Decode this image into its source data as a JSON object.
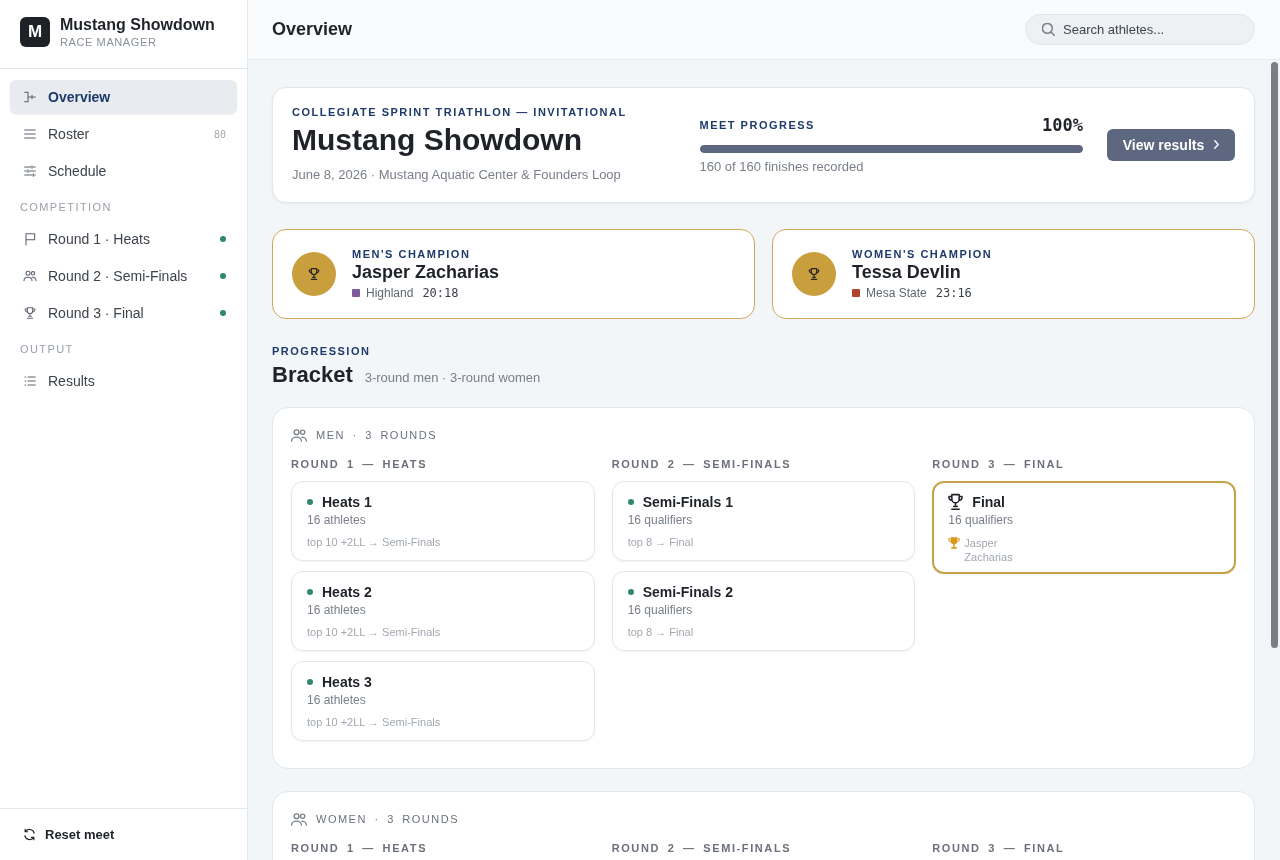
{
  "sidebar": {
    "brand": {
      "logo": "M",
      "title": "Mustang Showdown",
      "subtitle": "RACE MANAGER"
    },
    "sections": [
      {
        "items": [
          {
            "label": "Overview",
            "selected": true
          },
          {
            "label": "Roster",
            "count": "80",
            "selected": false
          },
          {
            "label": "Schedule",
            "selected": false
          }
        ]
      },
      {
        "heading": "COMPETITION",
        "items": [
          {
            "label": "Round 1 · Heats",
            "done": true,
            "selected": false
          },
          {
            "label": "Round 2 · Semi-Finals",
            "done": true,
            "selected": false
          },
          {
            "label": "Round 3 · Final",
            "done": true,
            "selected": false
          }
        ]
      },
      {
        "heading": "OUTPUT",
        "items": [
          {
            "label": "Results",
            "selected": false
          }
        ]
      }
    ],
    "footer": {
      "button": "Reset meet"
    }
  },
  "header": {
    "title": "Overview",
    "search": {
      "placeholder": "Search athletes..."
    }
  },
  "hero": {
    "eyebrow": "COLLEGIATE SPRINT TRIATHLON — INVITATIONAL",
    "title": "Mustang Showdown",
    "subtitle": "June 8, 2026 · Mustang Aquatic Center & Founders Loop",
    "progress": {
      "label": "MEET PROGRESS",
      "reading": "100%",
      "level": 1,
      "caption": "160 of 160 finishes recorded"
    },
    "button": "View results"
  },
  "champions": [
    {
      "label": "MEN'S CHAMPION",
      "name": "Jasper Zacharias",
      "team": "Highland",
      "color": "#7e5a9b",
      "time": "20:18"
    },
    {
      "label": "WOMEN'S CHAMPION",
      "name": "Tessa Devlin",
      "team": "Mesa State",
      "color": "#b0432c",
      "time": "23:16"
    }
  ],
  "progression": {
    "eyebrow": "PROGRESSION",
    "title": "Bracket",
    "subtitle": "3-round men · 3-round women"
  },
  "brackets": [
    {
      "title": "MEN · 3 ROUNDS",
      "rounds": [
        {
          "label": "ROUND 1 — HEATS",
          "races": [
            {
              "kind": "race",
              "title": "Heats 1",
              "count": "16 athletes",
              "note": "top 10 +2LL → Semi-Finals",
              "done": true
            },
            {
              "kind": "race",
              "title": "Heats 2",
              "count": "16 athletes",
              "note": "top 10 +2LL → Semi-Finals",
              "done": true
            },
            {
              "kind": "race",
              "title": "Heats 3",
              "count": "16 athletes",
              "note": "top 10 +2LL → Semi-Finals",
              "done": true
            }
          ]
        },
        {
          "label": "ROUND 2 — SEMI-FINALS",
          "races": [
            {
              "kind": "race",
              "title": "Semi-Finals 1",
              "count": "16 qualifiers",
              "note": "top 8 → Final",
              "done": true
            },
            {
              "kind": "race",
              "title": "Semi-Finals 2",
              "count": "16 qualifiers",
              "note": "top 8 → Final",
              "done": true
            }
          ]
        },
        {
          "label": "ROUND 3 — FINAL",
          "races": [
            {
              "kind": "final",
              "title": "Final",
              "count": "16 qualifiers",
              "winner": "Jasper Zacharias"
            }
          ]
        }
      ]
    },
    {
      "title": "WOMEN · 3 ROUNDS",
      "rounds": [
        {
          "label": "ROUND 1 — HEATS"
        },
        {
          "label": "ROUND 2 — SEMI-FINALS"
        },
        {
          "label": "ROUND 3 — FINAL"
        }
      ]
    }
  ]
}
